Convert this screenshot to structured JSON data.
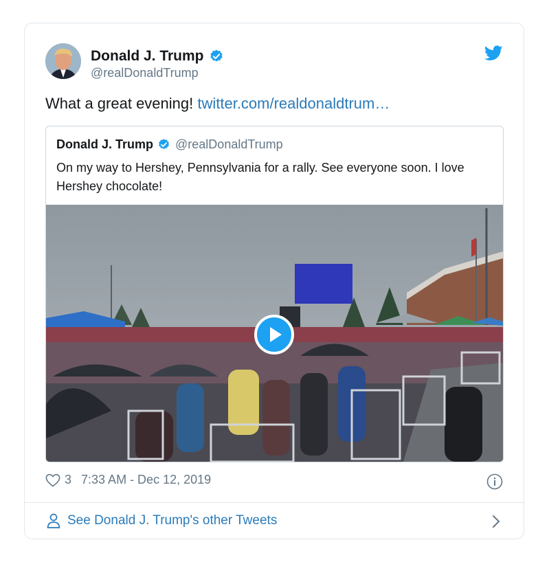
{
  "author": {
    "name": "Donald J. Trump",
    "handle": "@realDonaldTrump"
  },
  "icons": {
    "verified": "verified-badge-icon",
    "twitter": "twitter-bird-icon",
    "like": "heart-icon",
    "info": "info-icon",
    "profile": "person-icon",
    "chevron": "chevron-right-icon",
    "play": "play-icon"
  },
  "tweet": {
    "text": "What a great evening! ",
    "link": "twitter.com/realdonaldtrum…"
  },
  "quoted": {
    "name": "Donald J. Trump",
    "handle": "@realDonaldTrump",
    "text": "On my way to Hershey, Pennsylvania for a rally. See everyone soon. I love Hershey chocolate!"
  },
  "meta": {
    "likes": "3",
    "timestamp": "7:33 AM - Dec 12, 2019"
  },
  "footer": {
    "label": "See Donald J. Trump's other Tweets"
  },
  "colors": {
    "accent": "#1da1f2",
    "link": "#2b7bb9",
    "muted": "#657786",
    "border": "#e1e8ed"
  }
}
